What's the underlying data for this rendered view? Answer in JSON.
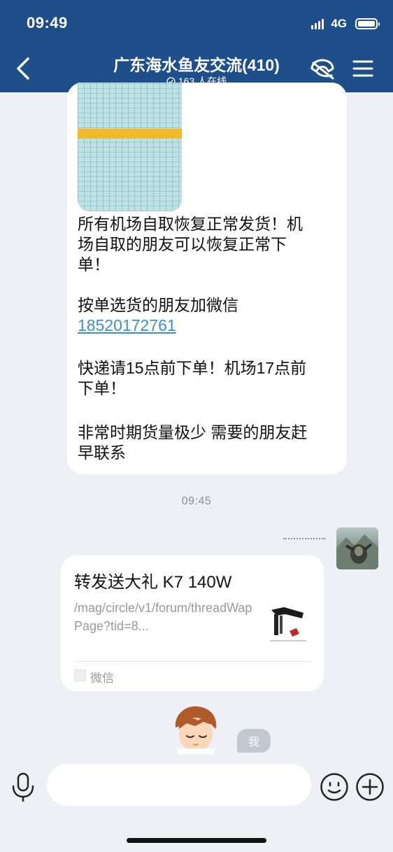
{
  "status_bar": {
    "time": "09:49",
    "network": "4G",
    "battery_level": 1.0
  },
  "header": {
    "title": "广东海水鱼友交流(410)",
    "online_count": "163 人在线"
  },
  "message1": {
    "lines": [
      "所有机场自取恢复正常发货！机",
      "场自取的朋友可以恢复正常下",
      "单！",
      "按单选货的朋友加微信",
      "快递请15点前下单！机场17点前",
      "下单！",
      "非常时期货量极少 需要的朋友赶",
      "早联系"
    ],
    "phone": "18520172761"
  },
  "time_divider": "09:45",
  "card": {
    "title": "转发送大礼 K7 140W",
    "url_text": "/mag/circle/v1/forum/threadWapPage?tid=8...",
    "source": "微信"
  },
  "me_badge": "我",
  "input": {
    "placeholder": ""
  },
  "icons": {
    "back": "back-icon",
    "call": "call-icon",
    "menu": "menu-icon",
    "mic": "mic-icon",
    "emoji": "emoji-icon",
    "plus": "plus-icon"
  },
  "colors": {
    "header_bg": "#1e4f8b",
    "link": "#3d8fd1",
    "background": "#eef0f5"
  }
}
